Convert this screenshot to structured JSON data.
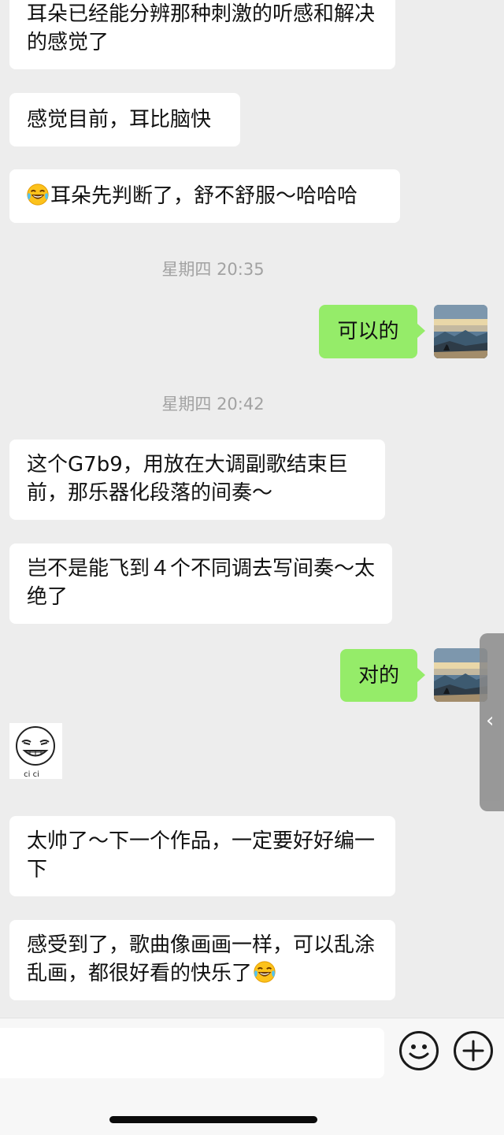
{
  "messages": {
    "m1": "耳朵已经能分辨那种刺激的听感和解决的感觉了",
    "m2": "感觉目前，耳比脑快",
    "m3": "耳朵先判断了，舒不舒服～哈哈哈",
    "t1": "星期四 20:35",
    "m4": "可以的",
    "t2": "星期四 20:42",
    "m5": "这个G7b9，用放在大调副歌结束巨前，那乐器化段落的间奏～",
    "m6": "岂不是能飞到４个不同调去写间奏～太绝了",
    "m7": "对的",
    "sticker_text": "ci ci",
    "m8": "太帅了～下一个作品，一定要好好编一下",
    "m9": "感受到了，歌曲像画画一样，可以乱涂乱画，都很好看的快乐了"
  },
  "icons": {
    "laugh": "face-with-tears-of-joy-icon",
    "emoji_button": "smiley-icon",
    "plus_button": "plus-icon",
    "side_handle": "chevron-left-icon"
  },
  "colors": {
    "background": "#ededed",
    "outgoing_bubble": "#95ec69",
    "incoming_bubble": "#ffffff",
    "timestamp": "#a2a2a2"
  }
}
